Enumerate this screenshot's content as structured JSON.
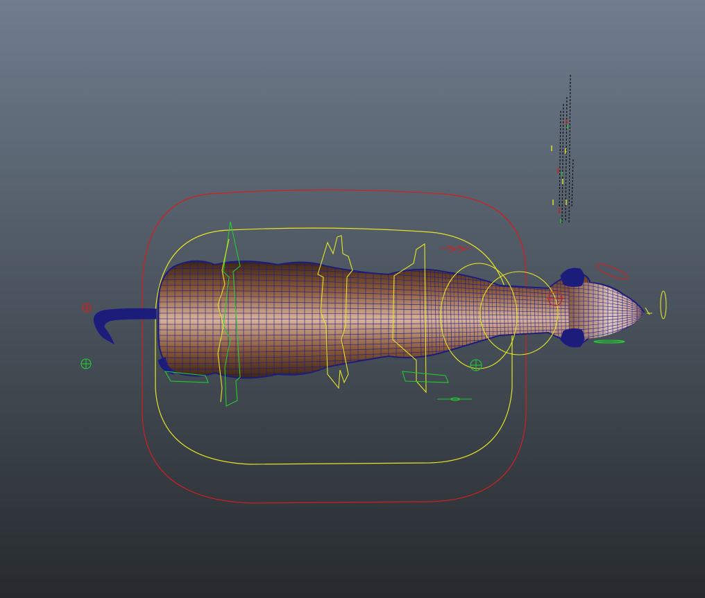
{
  "viewport": {
    "background_top": "#6f7d8d",
    "background_bottom": "#262a2e"
  },
  "colors": {
    "skin_shadow": "#3d2414",
    "skin_mid": "#8a5a3a",
    "skin_light": "#d9b29a",
    "skin_highlight": "#e8d0c6",
    "wireframe": "#1a1a8c",
    "hair_mesh": "#1c1d7a",
    "ctrl_red": "#d02020",
    "ctrl_yellow": "#e6e626",
    "ctrl_green": "#22cc33",
    "skeleton_black": "#101010"
  },
  "objects": {
    "mesh": "horse-body-mesh",
    "rig_controls": [
      "master-control",
      "root-control",
      "spine-controls",
      "neck-controls",
      "head-control",
      "leg-controls",
      "tail-control"
    ]
  }
}
